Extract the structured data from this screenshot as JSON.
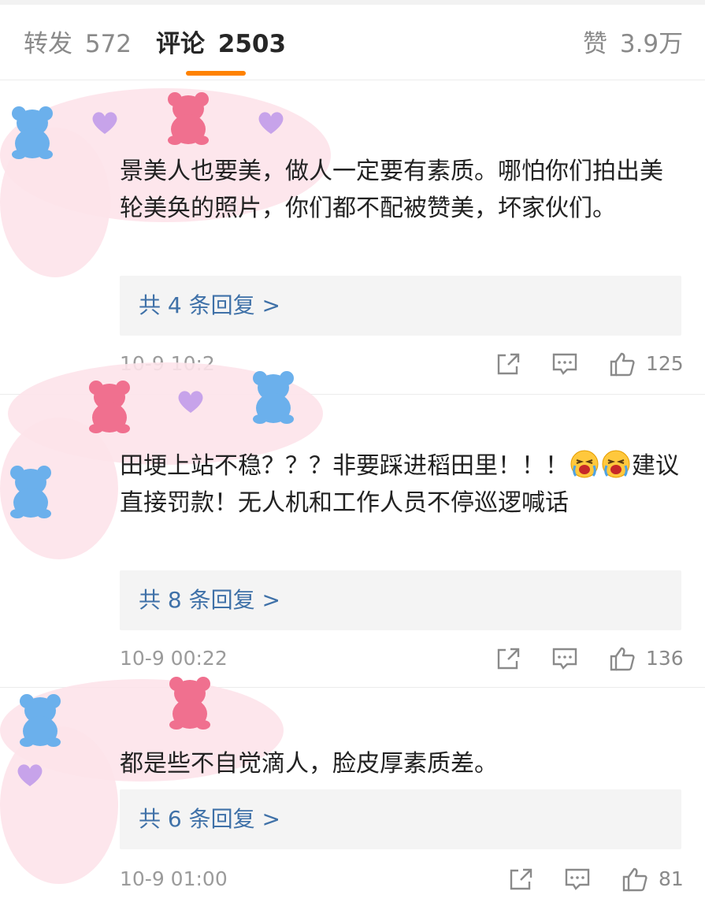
{
  "tabs": {
    "repost_label": "转发",
    "repost_count": "572",
    "comment_label": "评论",
    "comment_count": "2503",
    "like_label": "赞",
    "like_count": "3.9万"
  },
  "colors": {
    "accent": "#ff8200",
    "link": "#3f71a8",
    "reply_bg": "#f4f4f4",
    "meta_text": "#9b9b9b"
  },
  "comments": [
    {
      "text": "景美人也要美，做人一定要有素质。哪怕你们拍出美轮美奂的照片，你们都不配被赞美，坏家伙们。",
      "reply_link": "共 4 条回复 >",
      "time": "10-9 10:2",
      "likes": "125"
    },
    {
      "text_part1": "田埂上站不稳？？？非要踩进稻田里！！！",
      "text_part2": "建议直接罚款！无人机和工作人员不停巡逻喊话",
      "emoji": "crying-face-emoji",
      "reply_link": "共 8 条回复 >",
      "time": "10-9 00:22",
      "likes": "136"
    },
    {
      "text": "都是些不自觉滴人，脸皮厚素质差。",
      "reply_link": "共 6 条回复 >",
      "time": "10-9 01:00",
      "likes": "81"
    }
  ],
  "icons": {
    "share": "share-icon",
    "comment": "comment-icon",
    "like": "thumbs-up-icon"
  }
}
